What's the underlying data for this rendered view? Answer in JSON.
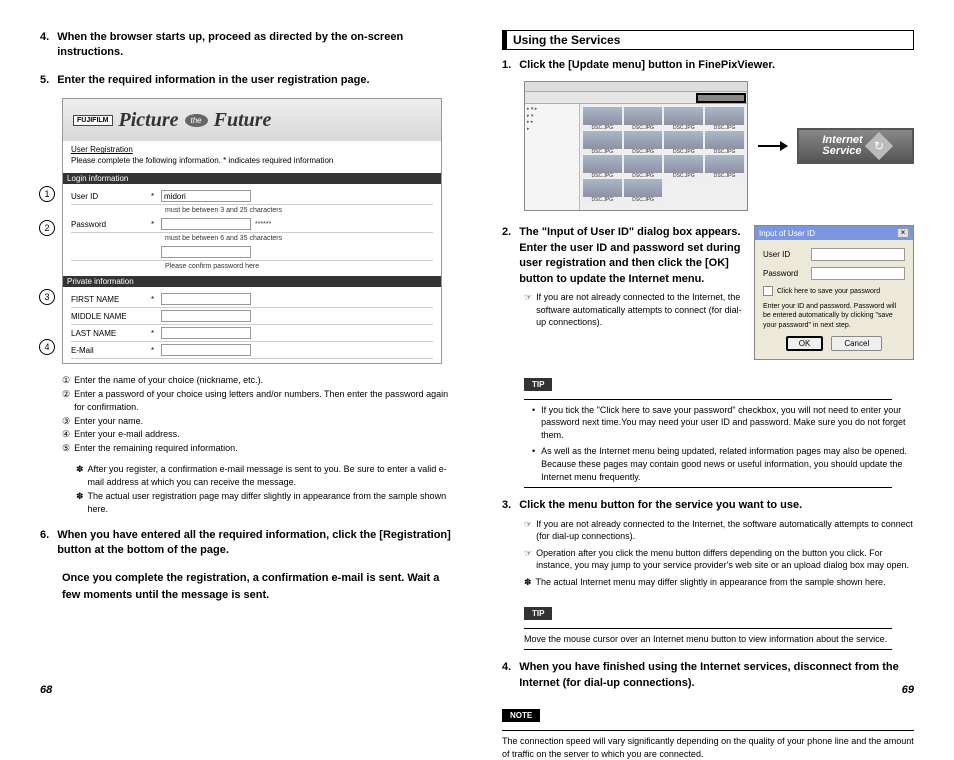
{
  "left": {
    "step4": {
      "num": "4.",
      "text": "When the browser starts up, proceed as directed by the on-screen instructions."
    },
    "step5": {
      "num": "5.",
      "text": "Enter the required information in the user registration page."
    },
    "banner": {
      "logo": "FUJIFILM",
      "t1": "Picture",
      "oval": "the",
      "t2": "Future"
    },
    "form": {
      "reg_title": "User Registration",
      "hint": "Please complete the following information. * indicates required information",
      "login_bar": "Login information",
      "userid_lbl": "User ID",
      "userid_val": "midori",
      "userid_hint": "must be between 3 and 25 characters",
      "pw_lbl": "Password",
      "pw_hint1": "must be between 6 and 35 characters",
      "pw_hint2": "Please confirm password here",
      "priv_bar": "Private information",
      "first": "FIRST NAME",
      "middle": "MIDDLE NAME",
      "last": "LAST NAME",
      "email": "E-Mail"
    },
    "markers": {
      "m1": "1",
      "m2": "2",
      "m3": "3",
      "m4": "4"
    },
    "legend": {
      "l1": {
        "c": "①",
        "t": "Enter the name of your choice (nickname, etc.)."
      },
      "l2": {
        "c": "②",
        "t": "Enter a password of your choice using letters and/or numbers. Then enter the password again for confirmation."
      },
      "l3": {
        "c": "③",
        "t": "Enter your name."
      },
      "l4": {
        "c": "④",
        "t": "Enter your e-mail address."
      },
      "l5": {
        "c": "⑤",
        "t": "Enter the remaining required information."
      }
    },
    "ast": {
      "a1": "After you register, a confirmation e-mail message is sent to you. Be sure to enter a valid e-mail address at which you can receive the message.",
      "a2": "The actual user registration page may differ slightly in appearance from the sample shown here."
    },
    "step6": {
      "num": "6.",
      "text": "When you have entered all the required information, click the [Registration] button at the bottom of the page."
    },
    "closing": "Once you complete the registration, a confirmation e-mail is sent. Wait a few moments until the message is sent.",
    "pagenum": "68"
  },
  "right": {
    "section": "Using the Services",
    "step1": {
      "num": "1.",
      "text": "Click the [Update menu] button in FinePixViewer."
    },
    "internet_btn": {
      "l1": "Internet",
      "l2": "Service",
      "icon": "↻"
    },
    "step2": {
      "num": "2.",
      "text": "The \"Input of User ID\" dialog box appears. Enter the user ID and password set during user registration and then click the [OK] button to update the Internet menu.",
      "sub": "If you are not already connected to the Internet, the software automatically attempts to connect (for dial-up connections)."
    },
    "dialog": {
      "title": "Input of User ID",
      "x": "×",
      "userid": "User ID",
      "password": "Password",
      "check": "Click here to save your password",
      "hint": "Enter your ID and password. Password will be entered automatically by clicking \"save your password\" in next step.",
      "ok": "OK",
      "cancel": "Cancel"
    },
    "tip": "TIP",
    "tip1_b1": "If you tick the \"Click here to save your password\" checkbox, you will not need to enter your password next time.You may need your user ID and password. Make sure you do not forget them.",
    "tip1_b2": "As well as the Internet menu being updated, related information pages may also be opened. Because these pages may contain good news or useful information, you should update the Internet menu frequently.",
    "step3": {
      "num": "3.",
      "text": "Click the menu button for the service you want to use.",
      "s1": "If you are not already connected to the Internet, the software automatically attempts to connect (for dial-up connections).",
      "s2": "Operation after you click the menu button differs depending on the button you click. For instance, you may jump to your service provider's web site or an upload dialog box may open.",
      "s3": "The actual Internet menu may differ slightly in appearance from the sample shown here."
    },
    "tip2_text": "Move the mouse cursor over an Internet menu button to view information about the service.",
    "step4": {
      "num": "4.",
      "text": "When you have finished using the Internet services, disconnect from the Internet (for dial-up connections)."
    },
    "note": "NOTE",
    "note_text": "The connection speed will vary significantly depending on the quality of your phone line and the amount of traffic on the server to which you are connected.",
    "pagenum": "69"
  }
}
